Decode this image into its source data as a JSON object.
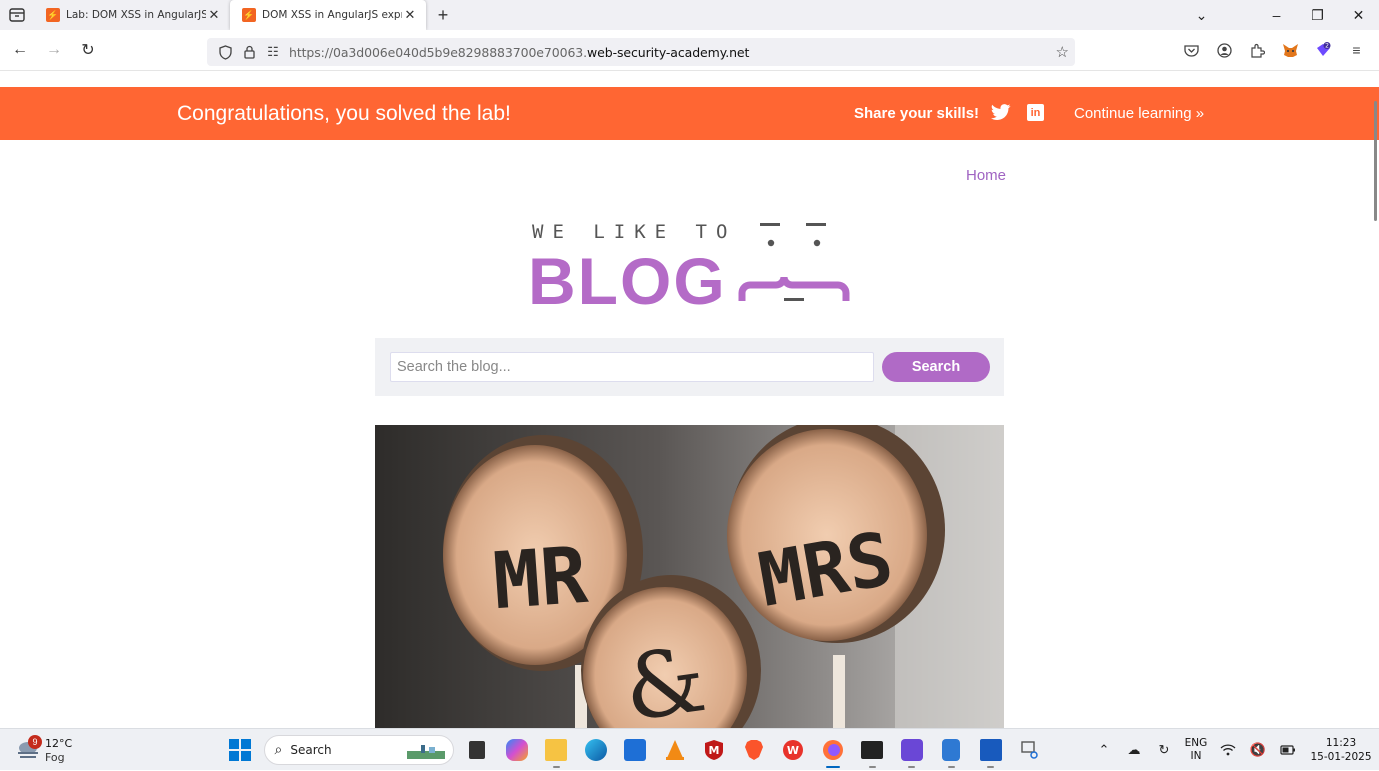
{
  "browser": {
    "tabs": [
      {
        "title": "Lab: DOM XSS in AngularJS exp",
        "active": false
      },
      {
        "title": "DOM XSS in AngularJS expressi",
        "active": true
      }
    ],
    "url_prefix": "https://0a3d006e040d5b9e8298883700e70063.",
    "url_domain": "web-security-academy.net"
  },
  "banner": {
    "message": "Congratulations, you solved the lab!",
    "share": "Share your skills!",
    "continue": "Continue learning »"
  },
  "nav": {
    "home": "Home"
  },
  "logo": {
    "small": "WE LIKE TO",
    "big": "BLOG"
  },
  "search": {
    "placeholder": "Search the blog...",
    "button": "Search"
  },
  "post": {
    "image_text": [
      "MR",
      "&",
      "MRS"
    ]
  },
  "taskbar": {
    "weather_badge": "9",
    "temperature": "12°C",
    "condition": "Fog",
    "search_label": "Search",
    "lang_line1": "ENG",
    "lang_line2": "IN",
    "time": "11:23",
    "date": "15-01-2025"
  },
  "colors": {
    "banner": "#ff6633",
    "accent": "#b06ac6",
    "search_bg": "#f0f1f4"
  }
}
